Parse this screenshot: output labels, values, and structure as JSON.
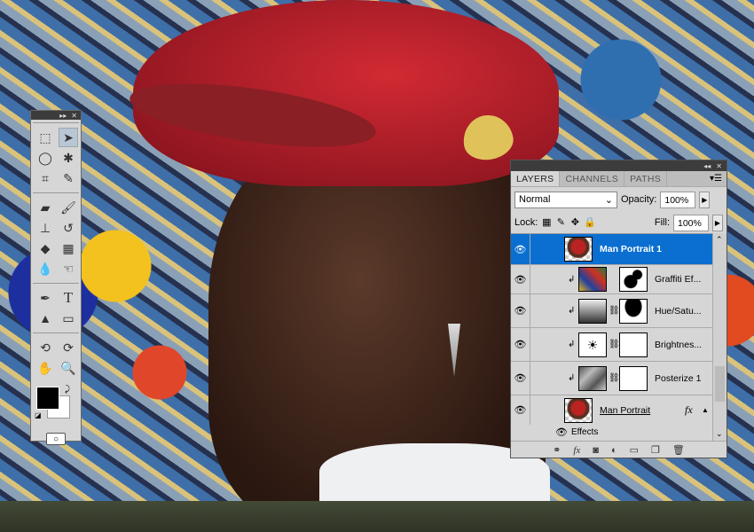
{
  "toolbox": {
    "tools": [
      "rectangular-marquee",
      "move",
      "lasso",
      "magic-wand",
      "crop",
      "eyedropper",
      "healing-brush",
      "brush",
      "clone-stamp",
      "history-brush",
      "eraser",
      "gradient",
      "blur",
      "smudge",
      "pen",
      "type",
      "path-selection",
      "rectangle",
      "3d-rotate",
      "3d-orbit",
      "hand",
      "zoom"
    ],
    "type_glyph": "T"
  },
  "layers_panel": {
    "tabs": [
      "LAYERS",
      "CHANNELS",
      "PATHS"
    ],
    "blend_mode": "Normal",
    "opacity_label": "Opacity:",
    "opacity": "100%",
    "lock_label": "Lock:",
    "fill_label": "Fill:",
    "fill": "100%",
    "layers": [
      {
        "name": "Man Portrait 1",
        "selected": true
      },
      {
        "name": "Graffiti Ef..."
      },
      {
        "name": "Hue/Satu..."
      },
      {
        "name": "Brightnes..."
      },
      {
        "name": "Posterize 1"
      },
      {
        "name": "Man Portrait",
        "fx": "fx"
      }
    ],
    "effects_label": "Effects",
    "footer_fx": "fx"
  },
  "colors": {
    "selection": "#0a6fd0",
    "panel": "#d6d6d6"
  }
}
